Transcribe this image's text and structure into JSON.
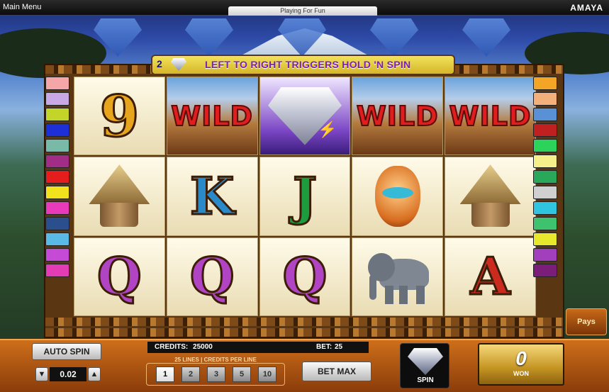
{
  "topbar": {
    "menu_label": "Main Menu",
    "mode_label": "Playing For Fun",
    "brand": "AMAYA"
  },
  "banner": {
    "count": "2",
    "message": "LEFT TO RIGHT TRIGGERS HOLD 'N SPIN"
  },
  "reels": [
    [
      "9",
      "hut",
      "Q"
    ],
    [
      "WILD",
      "K",
      "Q"
    ],
    [
      "diamond",
      "J",
      "Q"
    ],
    [
      "WILD",
      "mask",
      "elephant"
    ],
    [
      "WILD",
      "hut",
      "A"
    ]
  ],
  "symbols": {
    "wild_text": "WILD"
  },
  "left_markers": [
    "#f5a6a6",
    "#c8a9e6",
    "#c4d52a",
    "#1f2fd7",
    "#78b9a8",
    "#a12d87",
    "#e51d1d",
    "#f2e21d",
    "#e83ab9",
    "#2b4f8c",
    "#5bb9e6",
    "#c54ad6",
    "#e33cb5"
  ],
  "right_markers": [
    "#f5a525",
    "#f3b07a",
    "#5990d6",
    "#c12020",
    "#2bd35a",
    "#f5f08a",
    "#2aa85a",
    "#d0d0d0",
    "#2fc4e0",
    "#3ec26e",
    "#e8e82c",
    "#a23fbc",
    "#7a1e7a"
  ],
  "controls": {
    "auto_spin": "AUTO SPIN",
    "bet_value": "0.02",
    "credits_label": "CREDITS:",
    "credits_value": "25000",
    "bet_label": "BET:",
    "bet_amount": "25",
    "lines_caption": "25 LINES | CREDITS PER LINE",
    "line_options": [
      "1",
      "2",
      "3",
      "5",
      "10"
    ],
    "bet_max": "BET MAX",
    "spin": "SPIN",
    "win_value": "0",
    "win_label": "WON",
    "pays": "Pays"
  },
  "colors": {
    "banner_text": "#7e1db5",
    "wild_text": "#e11e1e",
    "panel": "#ce6f1a"
  }
}
